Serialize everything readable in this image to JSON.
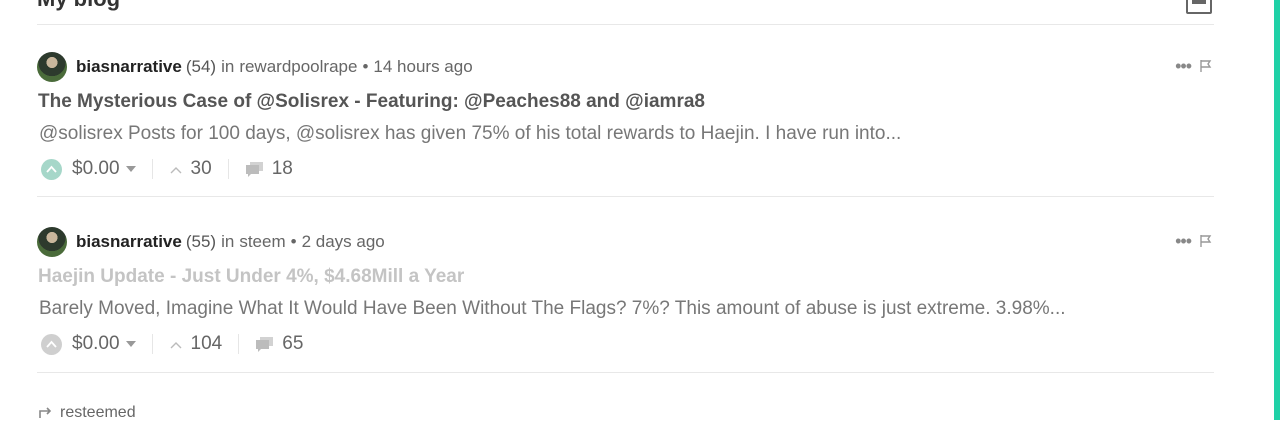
{
  "page": {
    "title": "My blog"
  },
  "colors": {
    "accent": "#1fd1a7",
    "vote_active": "#a6d7c9",
    "vote_inactive": "#cfcfcf"
  },
  "posts": [
    {
      "author": "biasnarrative",
      "reputation": "(54)",
      "in_word": "in",
      "category": "rewardpoolrape",
      "separator": "•",
      "time": "14 hours ago",
      "title": "The Mysterious Case of @Solisrex - Featuring: @Peaches88 and @iamra8",
      "excerpt": "@solisrex Posts for 100 days, @solisrex has given 75% of his total rewards to Haejin. I have run into...",
      "payout": "$0.00",
      "votes": "30",
      "comments": "18"
    },
    {
      "author": "biasnarrative",
      "reputation": "(55)",
      "in_word": "in",
      "category": "steem",
      "separator": "•",
      "time": "2 days ago",
      "title": "Haejin Update - Just Under 4%, $4.68Mill a Year",
      "excerpt": "Barely Moved, Imagine What It Would Have Been Without The Flags? 7%? This amount of abuse is just extreme. 3.98%...",
      "payout": "$0.00",
      "votes": "104",
      "comments": "65"
    }
  ],
  "footer": {
    "resteemed": "resteemed"
  },
  "icons": [
    "view-toggle-icon",
    "more-icon",
    "flag-icon",
    "upvote-icon",
    "votes-icon",
    "comments-icon",
    "resteem-icon"
  ]
}
